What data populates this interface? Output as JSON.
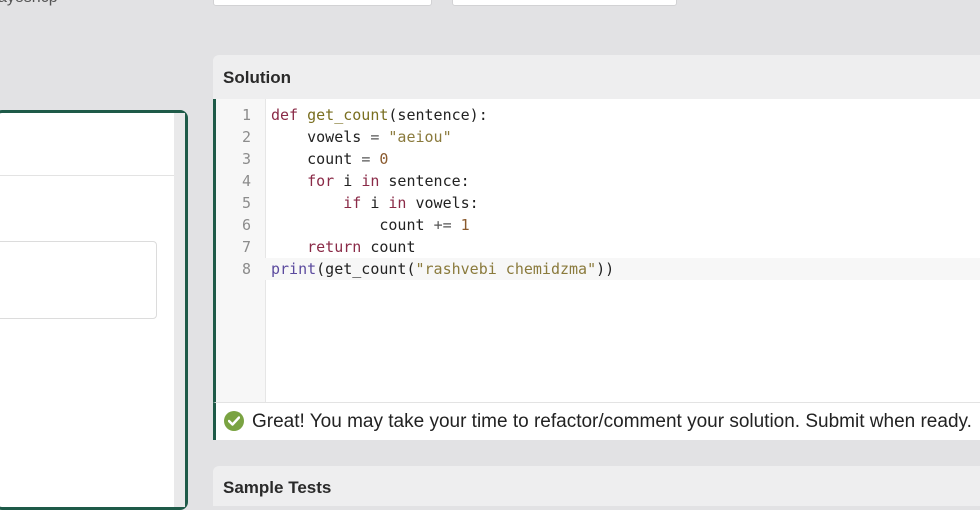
{
  "header": {
    "truncated_label": "ayesncp"
  },
  "solution": {
    "title": "Solution",
    "lines": [
      {
        "n": "1"
      },
      {
        "n": "2"
      },
      {
        "n": "3"
      },
      {
        "n": "4"
      },
      {
        "n": "5"
      },
      {
        "n": "6"
      },
      {
        "n": "7"
      },
      {
        "n": "8"
      }
    ],
    "code": {
      "l1_def": "def ",
      "l1_fn": "get_count",
      "l1_rest": "(sentence):",
      "l2_name": "    vowels ",
      "l2_op": "= ",
      "l2_str": "\"aeiou\"",
      "l3_name": "    count ",
      "l3_op": "= ",
      "l3_num": "0",
      "l4_kw1": "    for",
      "l4_mid": " i ",
      "l4_kw2": "in",
      "l4_rest": " sentence:",
      "l5_kw1": "        if",
      "l5_mid": " i ",
      "l5_kw2": "in",
      "l5_rest": " vowels:",
      "l6_name": "            count ",
      "l6_op": "+= ",
      "l6_num": "1",
      "l7_kw": "    return",
      "l7_rest": " count",
      "l8_builtin": "print",
      "l8_mid": "(get_count(",
      "l8_str": "\"rashvebi chemidzma\"",
      "l8_end": "))"
    }
  },
  "status": {
    "message": "Great! You may take your time to refactor/comment your solution. Submit when ready.",
    "icon": "check-circle-icon",
    "color": "#7aa342"
  },
  "sample_tests": {
    "title": "Sample Tests"
  }
}
